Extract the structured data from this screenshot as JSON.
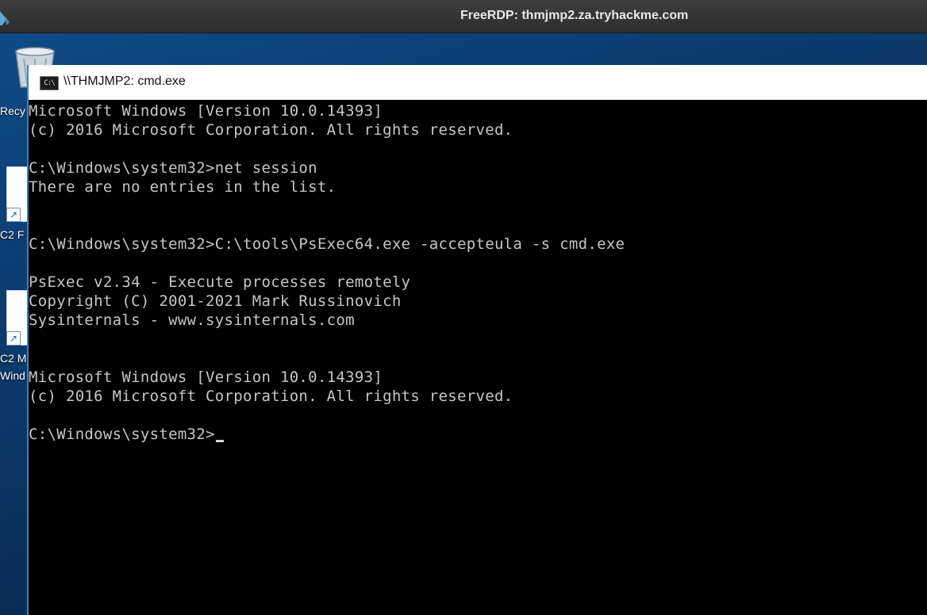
{
  "rdp_window": {
    "title": "FreeRDP: thmjmp2.za.tryhackme.com"
  },
  "desktop": {
    "icons": [
      {
        "label": "Recy",
        "icon": "recycle-bin-icon"
      },
      {
        "label": "C2 F",
        "icon": "shortcut-icon"
      },
      {
        "label_lines": [
          "C2 M",
          "Wind"
        ],
        "icon": "shortcut-icon"
      }
    ]
  },
  "cmd_window": {
    "title": "\\\\THMJMP2: cmd.exe",
    "icon_text": "C:\\",
    "lines": [
      "Microsoft Windows [Version 10.0.14393]",
      "(c) 2016 Microsoft Corporation. All rights reserved.",
      "",
      "C:\\Windows\\system32>net session",
      "There are no entries in the list.",
      "",
      "",
      "C:\\Windows\\system32>C:\\tools\\PsExec64.exe -accepteula -s cmd.exe",
      "",
      "PsExec v2.34 - Execute processes remotely",
      "Copyright (C) 2001-2021 Mark Russinovich",
      "Sysinternals - www.sysinternals.com",
      "",
      "",
      "Microsoft Windows [Version 10.0.14393]",
      "(c) 2016 Microsoft Corporation. All rights reserved.",
      "",
      "C:\\Windows\\system32>"
    ]
  },
  "colors": {
    "console_bg": "#000000",
    "console_text": "#c6c6c6",
    "rdp_bar": "#333333",
    "window_border": "#3c7fc4"
  }
}
